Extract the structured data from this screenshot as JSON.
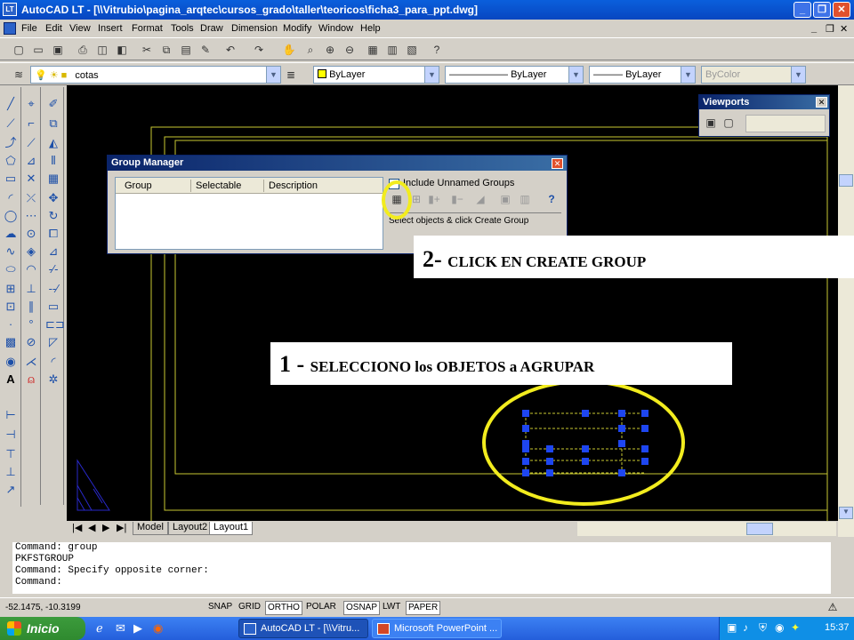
{
  "window": {
    "title": "AutoCAD LT - [\\\\Vitrubio\\pagina_arqtec\\cursos_grado\\taller\\teoricos\\ficha3_para_ppt.dwg]",
    "logo": "LT",
    "btn_min": "_",
    "btn_max": "❐",
    "btn_close": "✕"
  },
  "menubar": {
    "items": [
      "File",
      "Edit",
      "View",
      "Insert",
      "Format",
      "Tools",
      "Draw",
      "Dimension",
      "Modify",
      "Window",
      "Help"
    ],
    "doc_controls": [
      "_",
      "❐",
      "✕"
    ]
  },
  "properties": {
    "layer": "cotas",
    "color": "ByLayer",
    "linetype": "ByLayer",
    "lineweight": "ByLayer",
    "plotstyle": "ByColor",
    "linetype_line": "——————",
    "lineweight_line": "———"
  },
  "viewports_panel": {
    "title": "Viewports",
    "close": "✕"
  },
  "group_manager": {
    "title": "Group Manager",
    "close": "✕",
    "columns": [
      "Group",
      "Selectable",
      "Description"
    ],
    "checkbox_label": "Include Unnamed Groups",
    "hint": "Select objects & click Create Group",
    "help": "?"
  },
  "callouts": {
    "step2_number": "2-",
    "step2_text": "CLICK EN CREATE GROUP",
    "step1_number": "1 -",
    "step1_text": "SELECCIONO los OBJETOS a AGRUPAR"
  },
  "layout_tabs": {
    "nav": [
      "|◀",
      "◀",
      "▶",
      "▶|"
    ],
    "tabs": [
      "Model",
      "Layout2",
      "Layout1"
    ],
    "active": "Layout1"
  },
  "command": {
    "lines": [
      "Command: group",
      "PKFSTGROUP",
      "Command: Specify opposite corner:",
      "Command:"
    ]
  },
  "status": {
    "coords": "-52.1475, -10.3199",
    "toggles": [
      "SNAP",
      "GRID",
      "ORTHO",
      "POLAR",
      "OSNAP",
      "LWT",
      "PAPER"
    ]
  },
  "taskbar": {
    "start": "Inicio",
    "tasks": [
      "AutoCAD LT - [\\\\Vitru...",
      "Microsoft PowerPoint ..."
    ],
    "clock": "15:37"
  },
  "colors": {
    "canvas": "#000000",
    "layout_border": "#c8c832",
    "highlight": "#f2ec1e",
    "grip": "#1e46f0",
    "titlebar": "#0846c0"
  }
}
